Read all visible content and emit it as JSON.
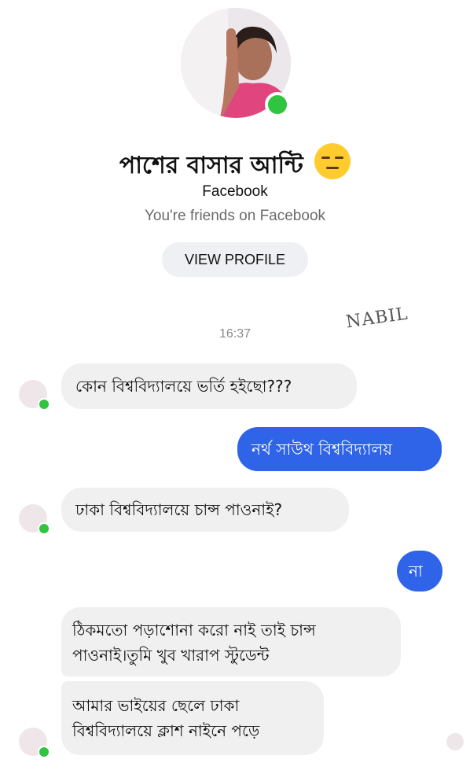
{
  "header": {
    "contact_name": "পাশের বাসার আন্টি",
    "contact_emoji": "expressionless-face-emoji",
    "platform": "Facebook",
    "friends_note": "You're friends on Facebook",
    "view_profile_label": "VIEW PROFILE",
    "online": true
  },
  "watermark": "NABIL",
  "timestamp": "16:37",
  "messages": [
    {
      "from": "contact",
      "text": "কোন বিশ্ববিদ্যালয়ে ভর্তি হইছো???"
    },
    {
      "from": "me",
      "text": "নর্থ সাউথ বিশ্ববিদ্যালয়"
    },
    {
      "from": "contact",
      "text": "ঢাকা বিশ্ববিদ্যালয়ে চান্স পাওনাই?"
    },
    {
      "from": "me",
      "text": "না"
    },
    {
      "from": "contact",
      "lines": [
        "ঠিকমতো পড়াশোনা করো নাই তাই চান্স",
        "পাওনাই।তুমি খুব খারাপ স্টুডেন্ট"
      ]
    },
    {
      "from": "contact",
      "lines": [
        "আমার ভাইয়ের ছেলে ঢাকা",
        "বিশ্ববিদ্যালয়ে ক্লাশ নাইনে পড়ে"
      ]
    }
  ],
  "colors": {
    "outgoing_bubble": "#2f63e8",
    "incoming_bubble": "#f0f0f1",
    "online_dot": "#31c43e",
    "secondary_text": "#6b6b6b"
  }
}
